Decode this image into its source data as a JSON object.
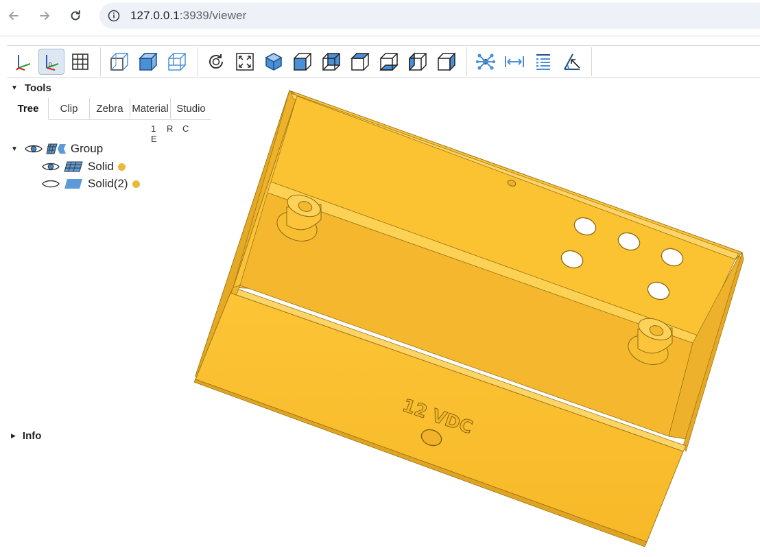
{
  "browser": {
    "url_host": "127.0.0.1",
    "url_rest": ":3939/viewer"
  },
  "toolbar": {
    "buttons": [
      {
        "name": "axes-icon",
        "active": false
      },
      {
        "name": "axes-origin-icon",
        "active": true
      },
      {
        "name": "grid-icon",
        "active": false
      },
      {
        "name": "transparent-icon",
        "active": false
      },
      {
        "name": "black-edges-icon",
        "active": false
      },
      {
        "name": "explode-icon",
        "active": false
      },
      {
        "name": "reset-view-icon",
        "active": false
      },
      {
        "name": "fit-view-icon",
        "active": false
      },
      {
        "name": "iso-view-icon",
        "active": false
      },
      {
        "name": "front-view-icon",
        "active": false
      },
      {
        "name": "rear-view-icon",
        "active": false
      },
      {
        "name": "top-view-icon",
        "active": false
      },
      {
        "name": "bottom-view-icon",
        "active": false
      },
      {
        "name": "left-view-icon",
        "active": false
      },
      {
        "name": "right-view-icon",
        "active": false
      },
      {
        "name": "explode-tool-icon",
        "active": false
      },
      {
        "name": "distance-measure-icon",
        "active": false
      },
      {
        "name": "properties-measure-icon",
        "active": false
      },
      {
        "name": "angle-measure-icon",
        "active": false
      }
    ]
  },
  "tools": {
    "title": "Tools",
    "tabs": [
      "Tree",
      "Clip",
      "Zebra",
      "Material",
      "Studio"
    ],
    "active_tab": "Tree",
    "columns": [
      "1",
      "R",
      "C",
      "E"
    ],
    "tree": [
      {
        "label": "Group",
        "visible": true,
        "level": 0
      },
      {
        "label": "Solid",
        "visible": true,
        "level": 1,
        "color": "#e8b93a"
      },
      {
        "label": "Solid(2)",
        "visible": false,
        "level": 1,
        "color": "#e8b93a"
      }
    ]
  },
  "info": {
    "title": "Info"
  },
  "viewport": {
    "part_color": "#fbbf2d",
    "label_text": "12 VDC"
  }
}
